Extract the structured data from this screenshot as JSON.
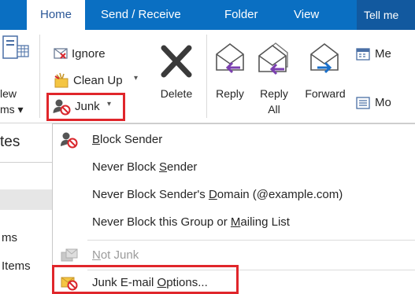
{
  "tabs": {
    "home": "Home",
    "send_receive": "Send / Receive",
    "folder": "Folder",
    "view": "View",
    "tell_me": "Tell me"
  },
  "ribbon": {
    "new_items_1": "lew",
    "new_items_2": "ms ▾",
    "ignore": "Ignore",
    "clean_up": "Clean Up",
    "junk": "Junk",
    "delete": "Delete",
    "reply": "Reply",
    "reply_all_1": "Reply",
    "reply_all_2": "All",
    "forward": "Forward",
    "meeting": "Me",
    "more": "Mo"
  },
  "left_pane": {
    "header": "tes",
    "item1": "ms",
    "item2": "Items"
  },
  "menu": {
    "block_sender": {
      "pre": "",
      "u": "B",
      "post": "lock Sender"
    },
    "never_block_sender": {
      "pre": "Never Block ",
      "u": "S",
      "post": "ender"
    },
    "never_block_domain": {
      "pre": "Never Block Sender's ",
      "u": "D",
      "post": "omain (@example.com)"
    },
    "never_block_group": {
      "pre": "Never Block this Group or ",
      "u": "M",
      "post": "ailing List"
    },
    "not_junk": {
      "pre": "",
      "u": "N",
      "post": "ot Junk"
    },
    "junk_options": {
      "pre": "Junk E-mail ",
      "u": "O",
      "post": "ptions..."
    }
  },
  "colors": {
    "accent": "#0a6fc2",
    "highlight_box": "#e0262b"
  }
}
